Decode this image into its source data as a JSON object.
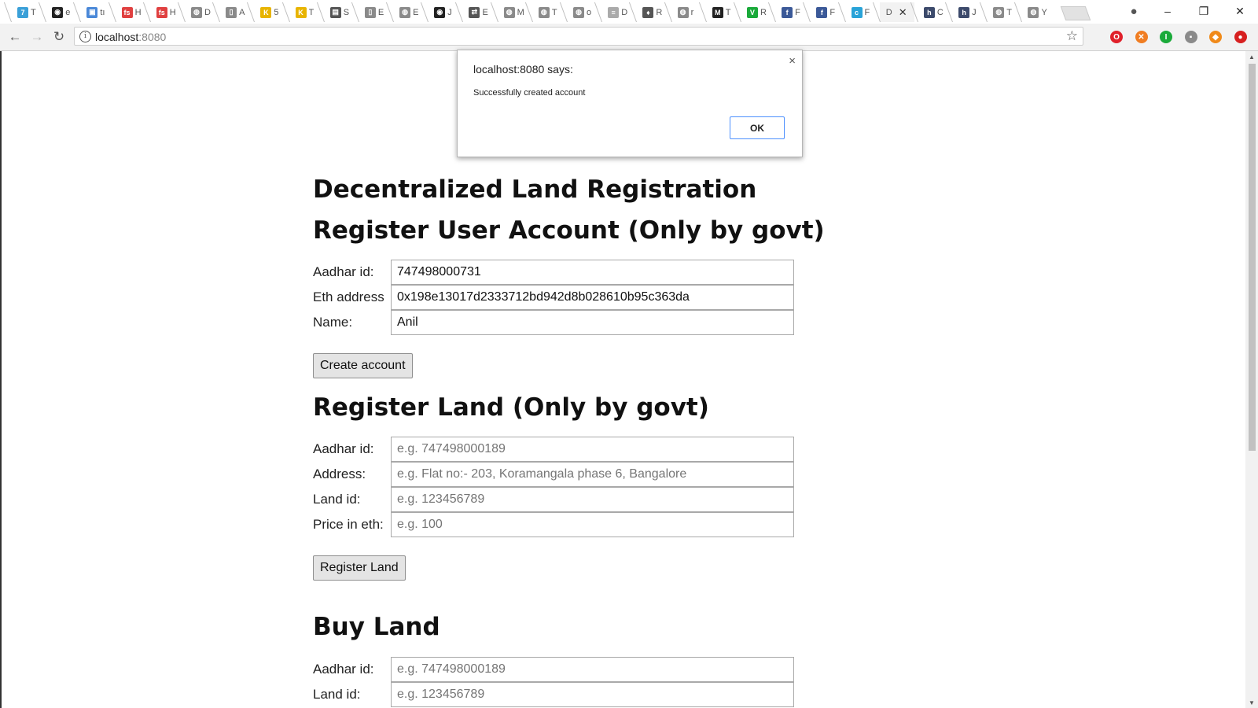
{
  "browser": {
    "tabs": [
      {
        "icon": "7",
        "label": "T",
        "color": "#3aa0d8"
      },
      {
        "icon": "◉",
        "label": "e",
        "color": "#222222"
      },
      {
        "icon": "▣",
        "label": "tı",
        "color": "#4a88d8"
      },
      {
        "icon": "fs",
        "label": "H",
        "color": "#e04040"
      },
      {
        "icon": "fs",
        "label": "H",
        "color": "#e04040"
      },
      {
        "icon": "◍",
        "label": "D",
        "color": "#8a8a8a"
      },
      {
        "icon": "▯",
        "label": "A",
        "color": "#8a8a8a"
      },
      {
        "icon": "K",
        "label": "5",
        "color": "#e8b400"
      },
      {
        "icon": "K",
        "label": "T",
        "color": "#e8b400"
      },
      {
        "icon": "▤",
        "label": "S",
        "color": "#555555"
      },
      {
        "icon": "▯",
        "label": "E",
        "color": "#8a8a8a"
      },
      {
        "icon": "◍",
        "label": "E",
        "color": "#8a8a8a"
      },
      {
        "icon": "◉",
        "label": "J",
        "color": "#222222"
      },
      {
        "icon": "⇄",
        "label": "E",
        "color": "#555555"
      },
      {
        "icon": "◍",
        "label": "M",
        "color": "#8a8a8a"
      },
      {
        "icon": "◍",
        "label": "T",
        "color": "#8a8a8a"
      },
      {
        "icon": "◍",
        "label": "o",
        "color": "#8a8a8a"
      },
      {
        "icon": "≡",
        "label": "D",
        "color": "#aaaaaa"
      },
      {
        "icon": "♦",
        "label": "R",
        "color": "#555555"
      },
      {
        "icon": "◍",
        "label": "r",
        "color": "#8a8a8a"
      },
      {
        "icon": "M",
        "label": "T",
        "color": "#222222"
      },
      {
        "icon": "V",
        "label": "R",
        "color": "#1aaa3a"
      },
      {
        "icon": "f",
        "label": "F",
        "color": "#3b5998"
      },
      {
        "icon": "f",
        "label": "F",
        "color": "#3b5998"
      },
      {
        "icon": "c",
        "label": "F",
        "color": "#29a3d8"
      },
      {
        "icon": "",
        "label": "D",
        "color": "#f2f2f2",
        "active": true
      },
      {
        "icon": "h",
        "label": "C",
        "color": "#3c4a6b"
      },
      {
        "icon": "h",
        "label": "J",
        "color": "#3c4a6b"
      },
      {
        "icon": "◍",
        "label": "T",
        "color": "#8a8a8a"
      },
      {
        "icon": "◍",
        "label": "Y",
        "color": "#8a8a8a"
      }
    ],
    "url_host": "localhost",
    "url_port": ":8080",
    "extensions": [
      {
        "name": "opera-icon",
        "glyph": "O",
        "color": "#e0202a"
      },
      {
        "name": "crossfire-icon",
        "glyph": "✕",
        "color": "#f07d22"
      },
      {
        "name": "ublock-icon",
        "glyph": "I",
        "color": "#1aaa3a"
      },
      {
        "name": "extension-icon",
        "glyph": "▪",
        "color": "#8a8a8a"
      },
      {
        "name": "metamask-icon",
        "glyph": "◆",
        "color": "#f08a1a"
      },
      {
        "name": "record-icon",
        "glyph": "●",
        "color": "#d72020"
      }
    ]
  },
  "dialog": {
    "title": "localhost:8080 says:",
    "message": "Successfully created account",
    "ok_label": "OK",
    "close_glyph": "×"
  },
  "page": {
    "title": "Decentralized Land Registration",
    "register_user": {
      "heading": "Register User Account (Only by govt)",
      "fields": [
        {
          "label": "Aadhar id:",
          "value": "747498000731",
          "placeholder": ""
        },
        {
          "label": "Eth address",
          "value": "0x198e13017d2333712bd942d8b028610b95c363da",
          "placeholder": ""
        },
        {
          "label": "Name:",
          "value": "Anil",
          "placeholder": ""
        }
      ],
      "button": "Create account"
    },
    "register_land": {
      "heading": "Register Land (Only by govt)",
      "fields": [
        {
          "label": "Aadhar id:",
          "value": "",
          "placeholder": "e.g. 747498000189"
        },
        {
          "label": "Address:",
          "value": "",
          "placeholder": "e.g. Flat no:- 203, Koramangala phase 6, Bangalore"
        },
        {
          "label": "Land id:",
          "value": "",
          "placeholder": "e.g. 123456789"
        },
        {
          "label": "Price in eth:",
          "value": "",
          "placeholder": "e.g. 100"
        }
      ],
      "button": "Register Land"
    },
    "buy_land": {
      "heading": "Buy Land",
      "fields": [
        {
          "label": "Aadhar id:",
          "value": "",
          "placeholder": "e.g. 747498000189"
        },
        {
          "label": "Land id:",
          "value": "",
          "placeholder": "e.g. 123456789"
        }
      ]
    }
  }
}
